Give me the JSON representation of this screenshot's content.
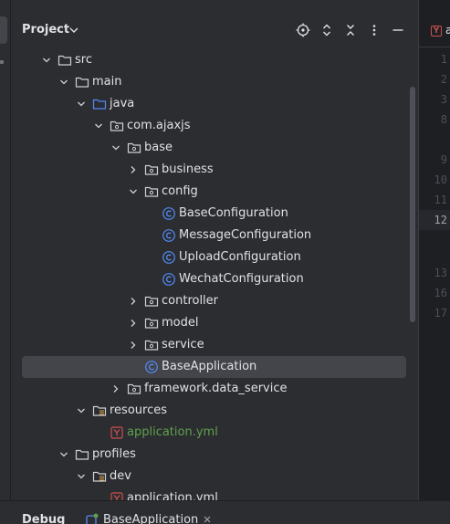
{
  "project_panel": {
    "title": "Project",
    "header_icons": [
      "crosshair-icon",
      "expand-collapse-icon",
      "collapse-all-icon",
      "more-vertical-icon",
      "minimize-icon"
    ]
  },
  "tree": [
    {
      "label": "src",
      "icon": "folder",
      "arrow": "down",
      "depth": 2
    },
    {
      "label": "main",
      "icon": "folder",
      "arrow": "down",
      "depth": 3
    },
    {
      "label": "java",
      "icon": "source-folder",
      "arrow": "down",
      "depth": 4
    },
    {
      "label": "com.ajaxjs",
      "icon": "package",
      "arrow": "down",
      "depth": 5
    },
    {
      "label": "base",
      "icon": "package",
      "arrow": "down",
      "depth": 6
    },
    {
      "label": "business",
      "icon": "package",
      "arrow": "right",
      "depth": 7
    },
    {
      "label": "config",
      "icon": "package",
      "arrow": "down",
      "depth": 7
    },
    {
      "label": "BaseConfiguration",
      "icon": "class",
      "arrow": "none",
      "depth": 8
    },
    {
      "label": "MessageConfiguration",
      "icon": "class",
      "arrow": "none",
      "depth": 8
    },
    {
      "label": "UploadConfiguration",
      "icon": "class",
      "arrow": "none",
      "depth": 8
    },
    {
      "label": "WechatConfiguration",
      "icon": "class",
      "arrow": "none",
      "depth": 8
    },
    {
      "label": "controller",
      "icon": "package",
      "arrow": "right",
      "depth": 7
    },
    {
      "label": "model",
      "icon": "package",
      "arrow": "right",
      "depth": 7
    },
    {
      "label": "service",
      "icon": "package",
      "arrow": "right",
      "depth": 7
    },
    {
      "label": "BaseApplication",
      "icon": "class",
      "arrow": "none",
      "depth": 7,
      "selected": true
    },
    {
      "label": "framework.data_service",
      "icon": "package",
      "arrow": "right",
      "depth": 6
    },
    {
      "label": "resources",
      "icon": "resources-folder",
      "arrow": "down",
      "depth": 4
    },
    {
      "label": "application.yml",
      "icon": "yaml-file",
      "arrow": "none",
      "depth": 5,
      "yml": true
    },
    {
      "label": "profiles",
      "icon": "folder",
      "arrow": "down",
      "depth": 3
    },
    {
      "label": "dev",
      "icon": "resources-folder",
      "arrow": "down",
      "depth": 4
    },
    {
      "label": "application.yml",
      "icon": "yaml-file",
      "arrow": "none",
      "depth": 5,
      "yml": false
    }
  ],
  "editor": {
    "tab_label": "a",
    "line_numbers": [
      "1",
      "2",
      "3",
      "8",
      "9",
      "10",
      "11",
      "12",
      "13",
      "16",
      "17"
    ],
    "current_line": "12"
  },
  "bottom_bar": {
    "title": "Debug",
    "session_label": "BaseApplication"
  },
  "colors": {
    "panel_bg": "#2b2d30",
    "editor_bg": "#1e1f22",
    "selection": "#43454a",
    "class_icon": "#548af7",
    "yml_text": "#5fa04e",
    "yml_icon": "#c94f4f"
  }
}
